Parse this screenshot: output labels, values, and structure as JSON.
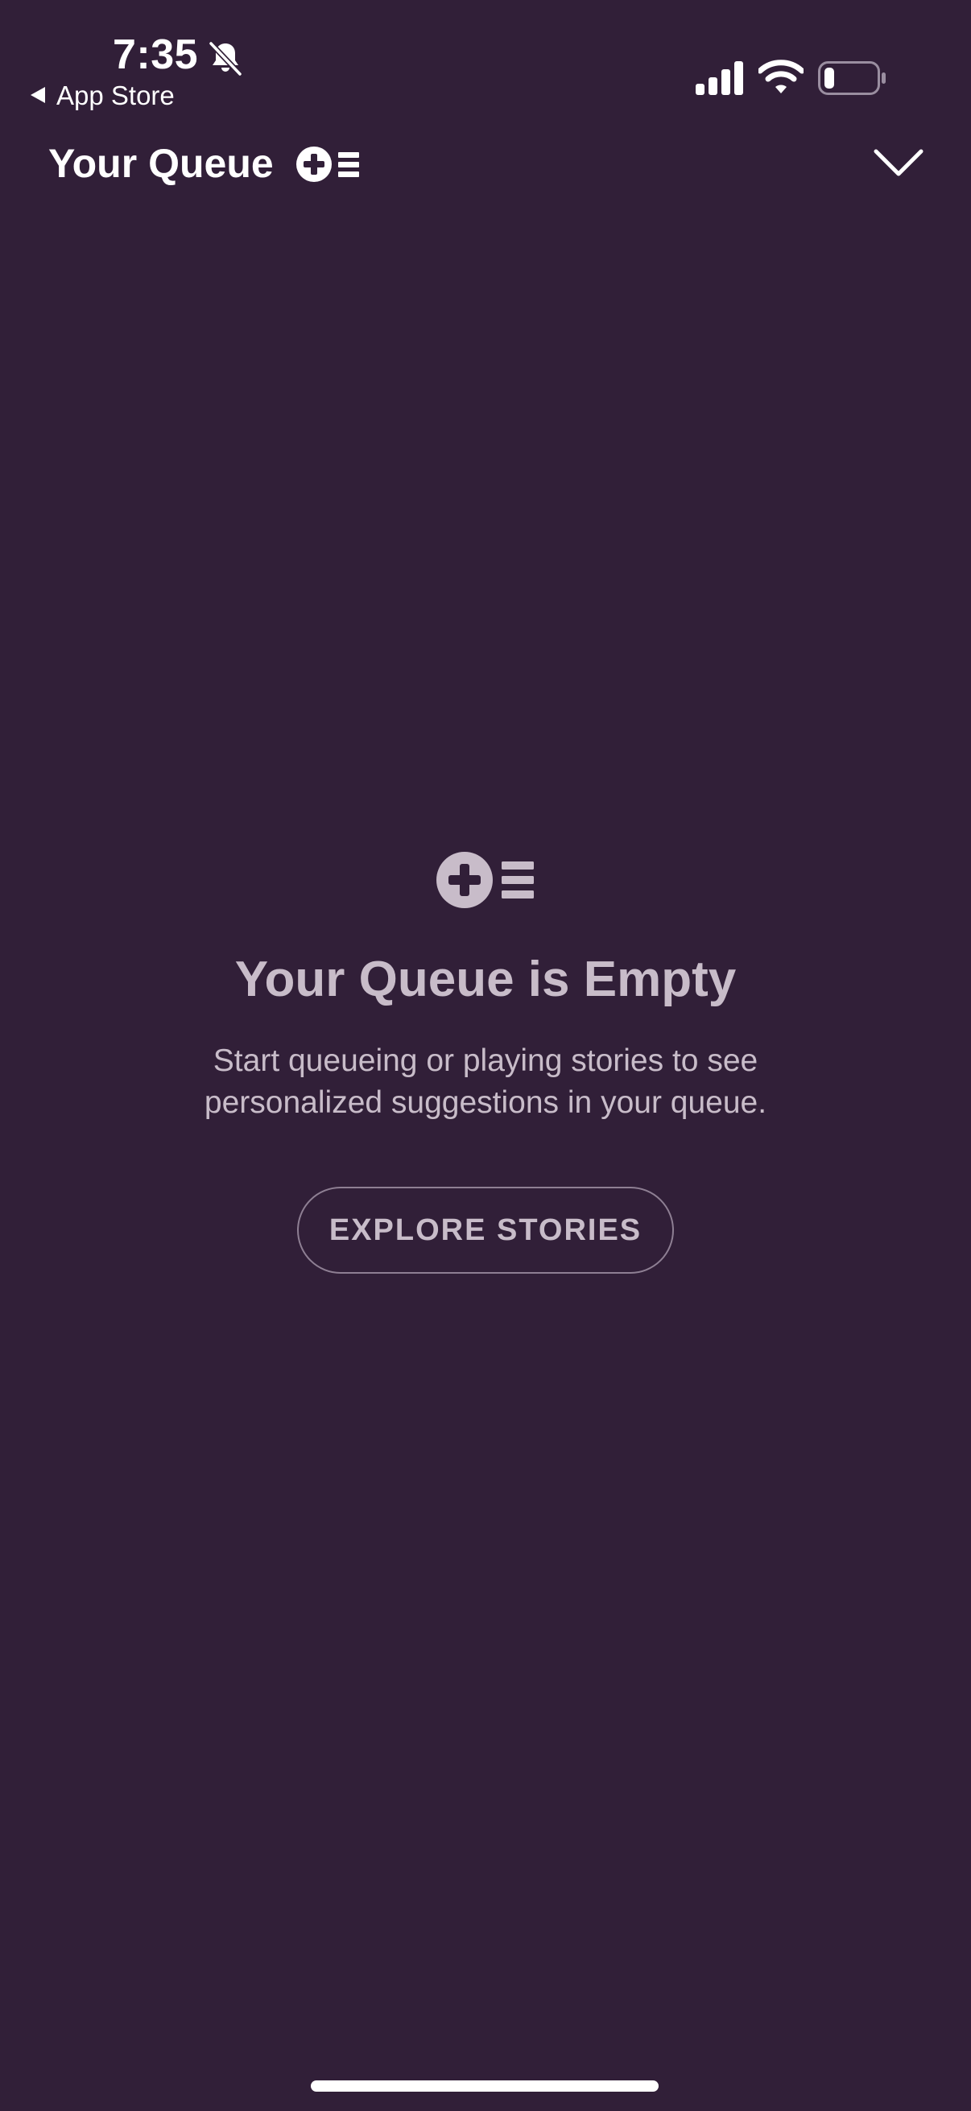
{
  "status_bar": {
    "time": "7:35",
    "back_app_label": "App Store",
    "icons": [
      "bell-slash-icon",
      "back-triangle-icon",
      "cellular-signal-icon",
      "wifi-icon",
      "battery-icon"
    ]
  },
  "header": {
    "title": "Your Queue",
    "queue_icon": "queue-add-icon",
    "collapse_icon": "chevron-down-icon"
  },
  "empty_state": {
    "icon": "queue-add-icon",
    "title": "Your Queue is Empty",
    "description": "Start queueing or playing stories to see personalized suggestions in your queue.",
    "button_label": "EXPLORE STORIES"
  },
  "colors": {
    "background": "#311f38",
    "muted_text": "#c8bcc9",
    "button_border": "#8e7f93",
    "primary_text": "#ffffff"
  }
}
